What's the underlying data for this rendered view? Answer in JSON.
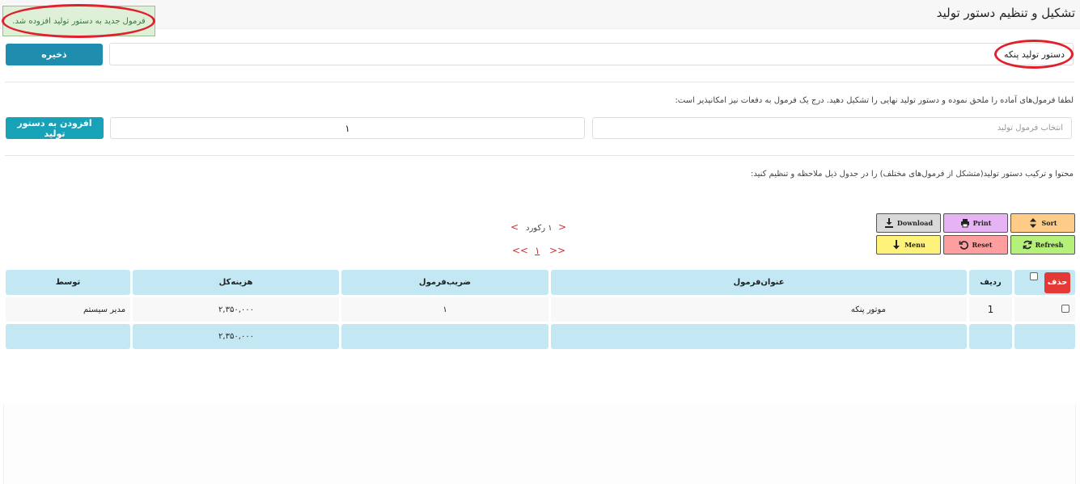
{
  "header": {
    "title": "تشکیل و تنظیم دستور تولید"
  },
  "alert": {
    "message": "فرمول جدید به دستور تولید افزوده شد."
  },
  "form": {
    "name_value": "دستور تولید پنکه",
    "save_label": "ذخیره",
    "help_text": "لطفا فرمول‌های آماده را ملحق نموده و دستور تولید نهایی را تشکیل دهید. درج یک فرمول به دفعات نیز امکانپذیر است:",
    "formula_placeholder": "انتخاب فرمول تولید",
    "quantity_value": "۱",
    "add_label": "افزودن به دستور تولید",
    "content_text": "محتوا و ترکیب دستور تولید(متشکل از فرمول‌های مختلف) را در جدول ذیل ملاحظه و تنظیم کنید:"
  },
  "toolbar": {
    "sort": "Sort",
    "print": "Print",
    "download": "Download",
    "refresh": "Refresh",
    "reset": "Reset",
    "menu": "Menu",
    "colors": {
      "sort": "#ffcc88",
      "print": "#e6b3f5",
      "download": "#d9d9d9",
      "refresh": "#b5f07a",
      "reset": "#ff9e9e",
      "menu": "#fff27a"
    }
  },
  "pager": {
    "prev": "<",
    "next": ">",
    "record_text": "۱ رکورد",
    "first": "<<",
    "last": ">>",
    "current_page": "۱"
  },
  "table": {
    "delete_label": "حذف",
    "headers": {
      "row": "ردیف",
      "title": "عنوان‌فرمول",
      "factor": "ضریب‌فرمول",
      "cost": "هزینه‌کل",
      "by": "توسط"
    },
    "rows": [
      {
        "row": "1",
        "title": "موتور پنکه",
        "factor": "۱",
        "cost": "۲,۳۵۰,۰۰۰",
        "by": "مدیر سیستم"
      }
    ],
    "footer": {
      "cost_total": "۲,۳۵۰,۰۰۰"
    }
  }
}
